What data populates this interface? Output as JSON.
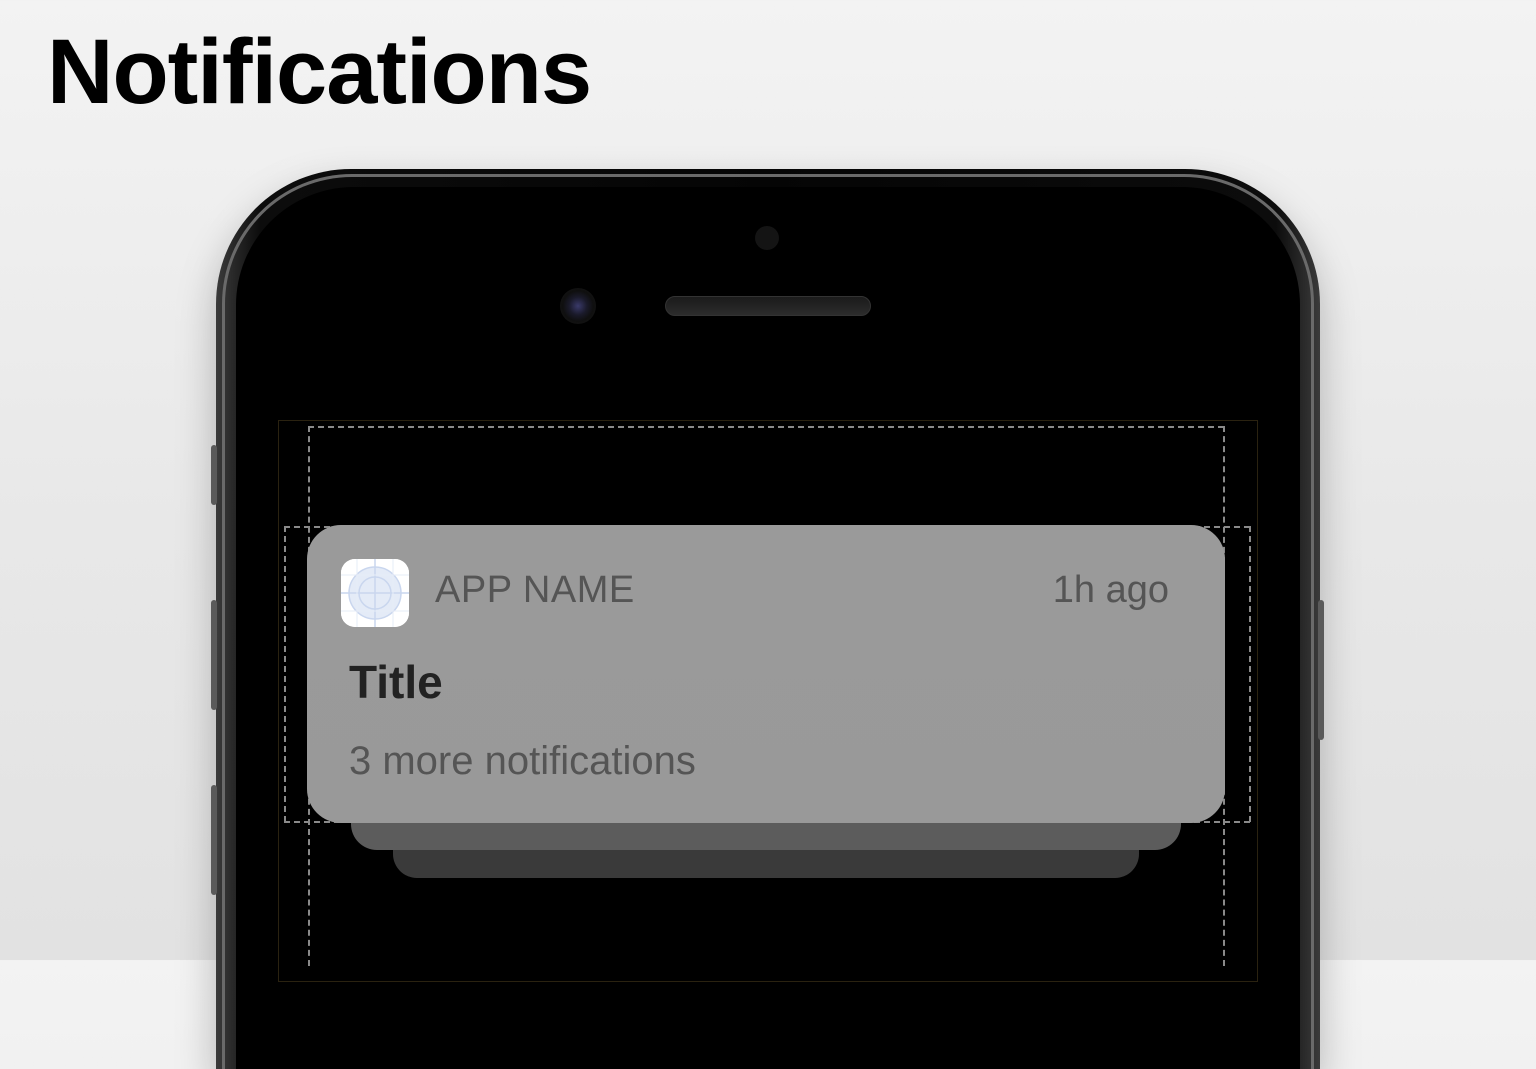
{
  "page": {
    "title": "Notifications"
  },
  "notification": {
    "app_name": "APP NAME",
    "time": "1h ago",
    "title": "Title",
    "body": "3 more notifications",
    "stacked_count": 3,
    "icon": "app-placeholder-icon"
  },
  "colors": {
    "background": "#eeeeee",
    "phone_body": "#050505",
    "screen": "#000000",
    "card": "#9a9a9a",
    "secondary_text": "#555555",
    "primary_text": "#222222"
  }
}
